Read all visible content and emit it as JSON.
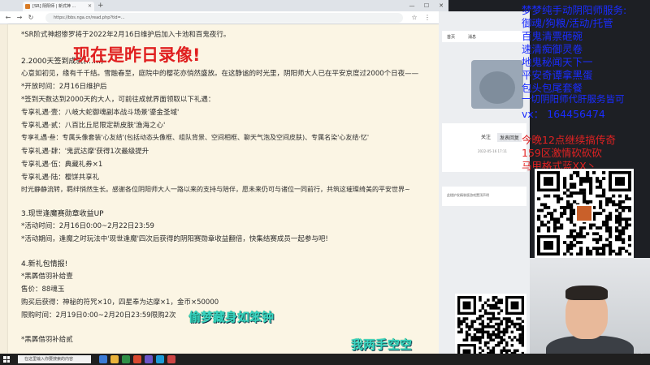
{
  "browser": {
    "tab_title": "[SR] 阴阳师 | 新式神 ...",
    "url": "https://bbs.nga.cn/read.php?tid=...",
    "win_min": "—",
    "win_max": "☐",
    "win_close": "✕"
  },
  "article": {
    "lines": [
      "*SR阶式神超惨罗将于2022年2月16日维护后加入卡池和百鬼夜行。",
      "2.2000天签到成就(……)",
      "心意如初见，缘有千千结。雪融春至，庭院中的樱花亦悄然盛放。在这静谧的时光里，阴阳师大人已在平安京度过2000个日夜——",
      "*开放时间：2月16日维护后",
      "*签到天数达到2000天的大人，可前往成就界面领取以下礼遇：",
      "专享礼遇·壹：八岐大蛇御魂副本战斗场景'鎏金圣域'",
      "专享礼遇·贰：八百比丘尼限定新皮肤'渔海之心'",
      "专享礼遇·叁：专属头像套装'心友结'(包括动态头像框、组队背景、空间相框、聊天气泡及空间皮肤)、专属名染'心友结·忆'",
      "专享礼遇·肆：'鬼武达摩'获得1次最级提升",
      "专享礼遇·伍：典藏礼券×1",
      "专享礼遇·陆：樱饼共享礼",
      "时光静静流转，羁绊悄然生长。感谢各位阴阳师大人一路以来的支持与陪伴，愿未来仍可与诸位一同前行，共筑这璀璨绮美的平安世界~",
      "3.现世逢魔赛勋章收益UP",
      "*活动时间：2月16日0:00~2月22日23:59",
      "*活动期间，逢魔之时玩法中'现世逢魔'四次后获得的阴阳赛勋章收益翻倍，快集结赛成员一起参与吧!",
      "4.新礼包情报!",
      "*黑羼借羽补给壹",
      "售价：88魂玉",
      "购买后获得：神秘的符咒×10，四星奉为达摩×1，金币×50000",
      "限购时间：2月19日0:00~2月20日23:59限购2次",
      "*黑羼借羽补给贰"
    ]
  },
  "overlays": {
    "replay_notice": "现在是昨日录像!",
    "slogan_1": "偷梦藏身如笨钟",
    "slogan_2": "我两手空空",
    "services": [
      "梦梦纯手动阴阳师服务:",
      "御魂/狗粮/活动/托管",
      "百鬼清票砸碗",
      "速清痴御灵卷",
      "地鬼秘闻天下一",
      "平安奇谭拿黑蛋",
      "包头包尾套餐",
      "一切阴阳师代肝服务皆可",
      "vx： 164456474"
    ],
    "schedule": [
      "今晚12点继续搞传奇",
      "159区激情砍砍砍",
      "马甲格式蓝XX丶"
    ]
  },
  "side_panel": {
    "tab_a": "首页",
    "tab_b": "消息",
    "follow": "关注",
    "reply": "发表回复",
    "meta": "2022-05-16 17:11",
    "note": "此楼护发精装版游戏置顶声明"
  },
  "taskbar": {
    "search_placeholder": "在这里输入你要搜索的内容"
  },
  "colors": {
    "overlay_red": "#e02020",
    "overlay_blue": "#1a2cff",
    "overlay_teal": "#3ad2c2",
    "paper": "#fbf5e4"
  }
}
